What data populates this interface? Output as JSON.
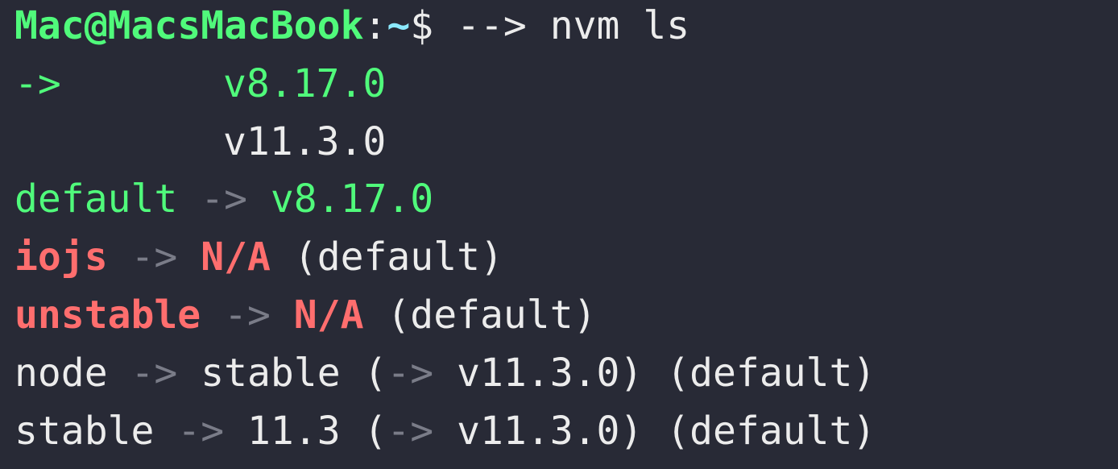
{
  "window": {
    "colors": {
      "background": "#282a36",
      "green": "#50fa7b",
      "blue": "#8be9fd",
      "red": "#ff6e6e",
      "text": "#ececec",
      "dim": "#7a7c88"
    }
  },
  "prompt": {
    "user_host": "Mac@MacsMacBook",
    "separator": ":",
    "path": "~",
    "symbol": "$",
    "arrow": "-->",
    "command": "nvm ls"
  },
  "output": {
    "installed": [
      {
        "marker": "->",
        "version": "v8.17.0"
      },
      {
        "marker": "",
        "version": "v11.3.0"
      }
    ],
    "aliases": [
      {
        "name": "default",
        "arrow": "->",
        "target": "v8.17.0",
        "resolved_arrow": "",
        "resolved": "",
        "suffix": ""
      },
      {
        "name": "iojs",
        "arrow": "->",
        "target": "N/A",
        "resolved_arrow": "",
        "resolved": "",
        "suffix": "(default)"
      },
      {
        "name": "unstable",
        "arrow": "->",
        "target": "N/A",
        "resolved_arrow": "",
        "resolved": "",
        "suffix": "(default)"
      },
      {
        "name": "node",
        "arrow": "->",
        "target": "stable",
        "open_paren": "(",
        "resolved_arrow": "->",
        "resolved": "v11.3.0",
        "close_paren": ")",
        "suffix": "(default)"
      },
      {
        "name": "stable",
        "arrow": "->",
        "target": "11.3",
        "open_paren": "(",
        "resolved_arrow": "->",
        "resolved": "v11.3.0",
        "close_paren": ")",
        "suffix": "(default)"
      }
    ]
  }
}
